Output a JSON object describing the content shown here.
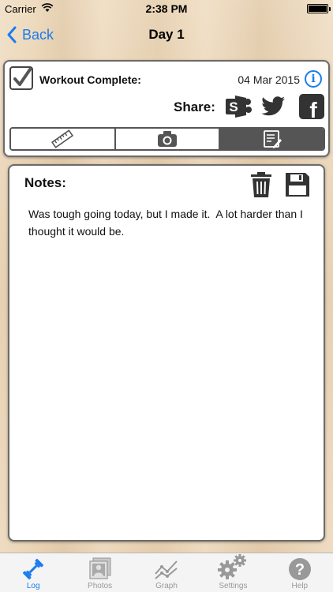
{
  "status": {
    "carrier": "Carrier",
    "time": "2:38 PM"
  },
  "nav": {
    "back_label": "Back",
    "title": "Day 1"
  },
  "workout": {
    "checkbox_checked": true,
    "label": "Workout Complete:",
    "date": "04 Mar 2015",
    "info_icon": "info-icon"
  },
  "share": {
    "label": "Share:",
    "icons": [
      "sharepoint-icon",
      "twitter-icon",
      "facebook-icon"
    ]
  },
  "segments": [
    {
      "icon": "ruler-icon",
      "selected": false
    },
    {
      "icon": "camera-icon",
      "selected": false
    },
    {
      "icon": "notes-icon",
      "selected": true
    }
  ],
  "notes": {
    "label": "Notes:",
    "text": "Was tough going today, but I made it.  A lot harder than I thought it would be."
  },
  "tabs": [
    {
      "label": "Log",
      "icon": "dumbbell-icon",
      "active": true
    },
    {
      "label": "Photos",
      "icon": "photos-icon",
      "active": false
    },
    {
      "label": "Graph",
      "icon": "graph-icon",
      "active": false
    },
    {
      "label": "Settings",
      "icon": "gears-icon",
      "active": false
    },
    {
      "label": "Help",
      "icon": "help-icon",
      "active": false
    }
  ],
  "colors": {
    "accent": "#1a7cf0",
    "selected_segment": "#555555",
    "sharepoint": "#333333",
    "facebook": "#333333"
  }
}
